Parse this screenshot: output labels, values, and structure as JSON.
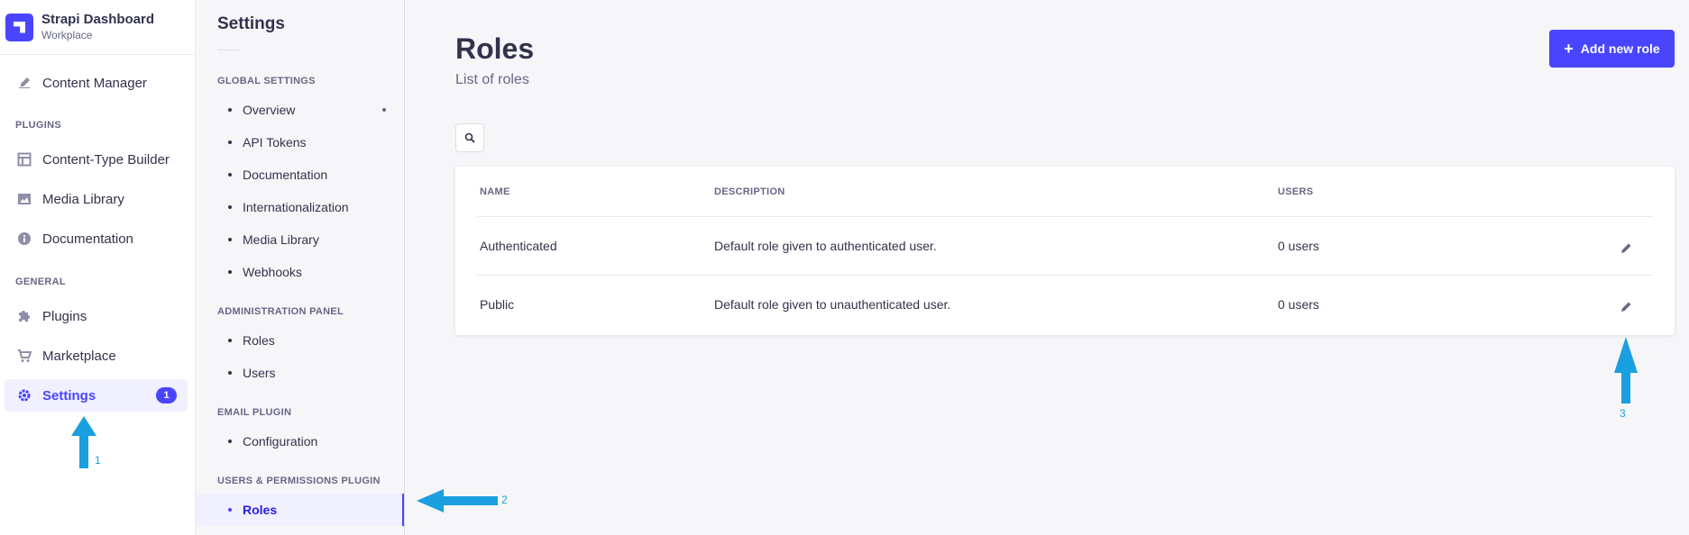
{
  "brand": {
    "title": "Strapi Dashboard",
    "subtitle": "Workplace"
  },
  "mainnav": {
    "content_manager": "Content Manager",
    "plugins_section": "PLUGINS",
    "content_type_builder": "Content-Type Builder",
    "media_library": "Media Library",
    "documentation": "Documentation",
    "general_section": "GENERAL",
    "plugins": "Plugins",
    "marketplace": "Marketplace",
    "settings": "Settings",
    "settings_badge": "1"
  },
  "subnav": {
    "title": "Settings",
    "global_section": "GLOBAL SETTINGS",
    "global_items": [
      "Overview",
      "API Tokens",
      "Documentation",
      "Internationalization",
      "Media Library",
      "Webhooks"
    ],
    "admin_section": "ADMINISTRATION PANEL",
    "admin_items": [
      "Roles",
      "Users"
    ],
    "email_section": "EMAIL PLUGIN",
    "email_items": [
      "Configuration"
    ],
    "users_section": "USERS & PERMISSIONS PLUGIN",
    "users_items": [
      "Roles"
    ]
  },
  "main": {
    "title": "Roles",
    "subtitle": "List of roles",
    "add_button": "Add new role"
  },
  "table": {
    "headers": {
      "name": "NAME",
      "description": "DESCRIPTION",
      "users": "USERS"
    },
    "rows": [
      {
        "name": "Authenticated",
        "description": "Default role given to authenticated user.",
        "users": "0 users"
      },
      {
        "name": "Public",
        "description": "Default role given to unauthenticated user.",
        "users": "0 users"
      }
    ]
  },
  "annotations": {
    "one": "1",
    "two": "2",
    "three": "3"
  },
  "colors": {
    "accent": "#4945ff",
    "annotation": "#1aa0e0"
  }
}
